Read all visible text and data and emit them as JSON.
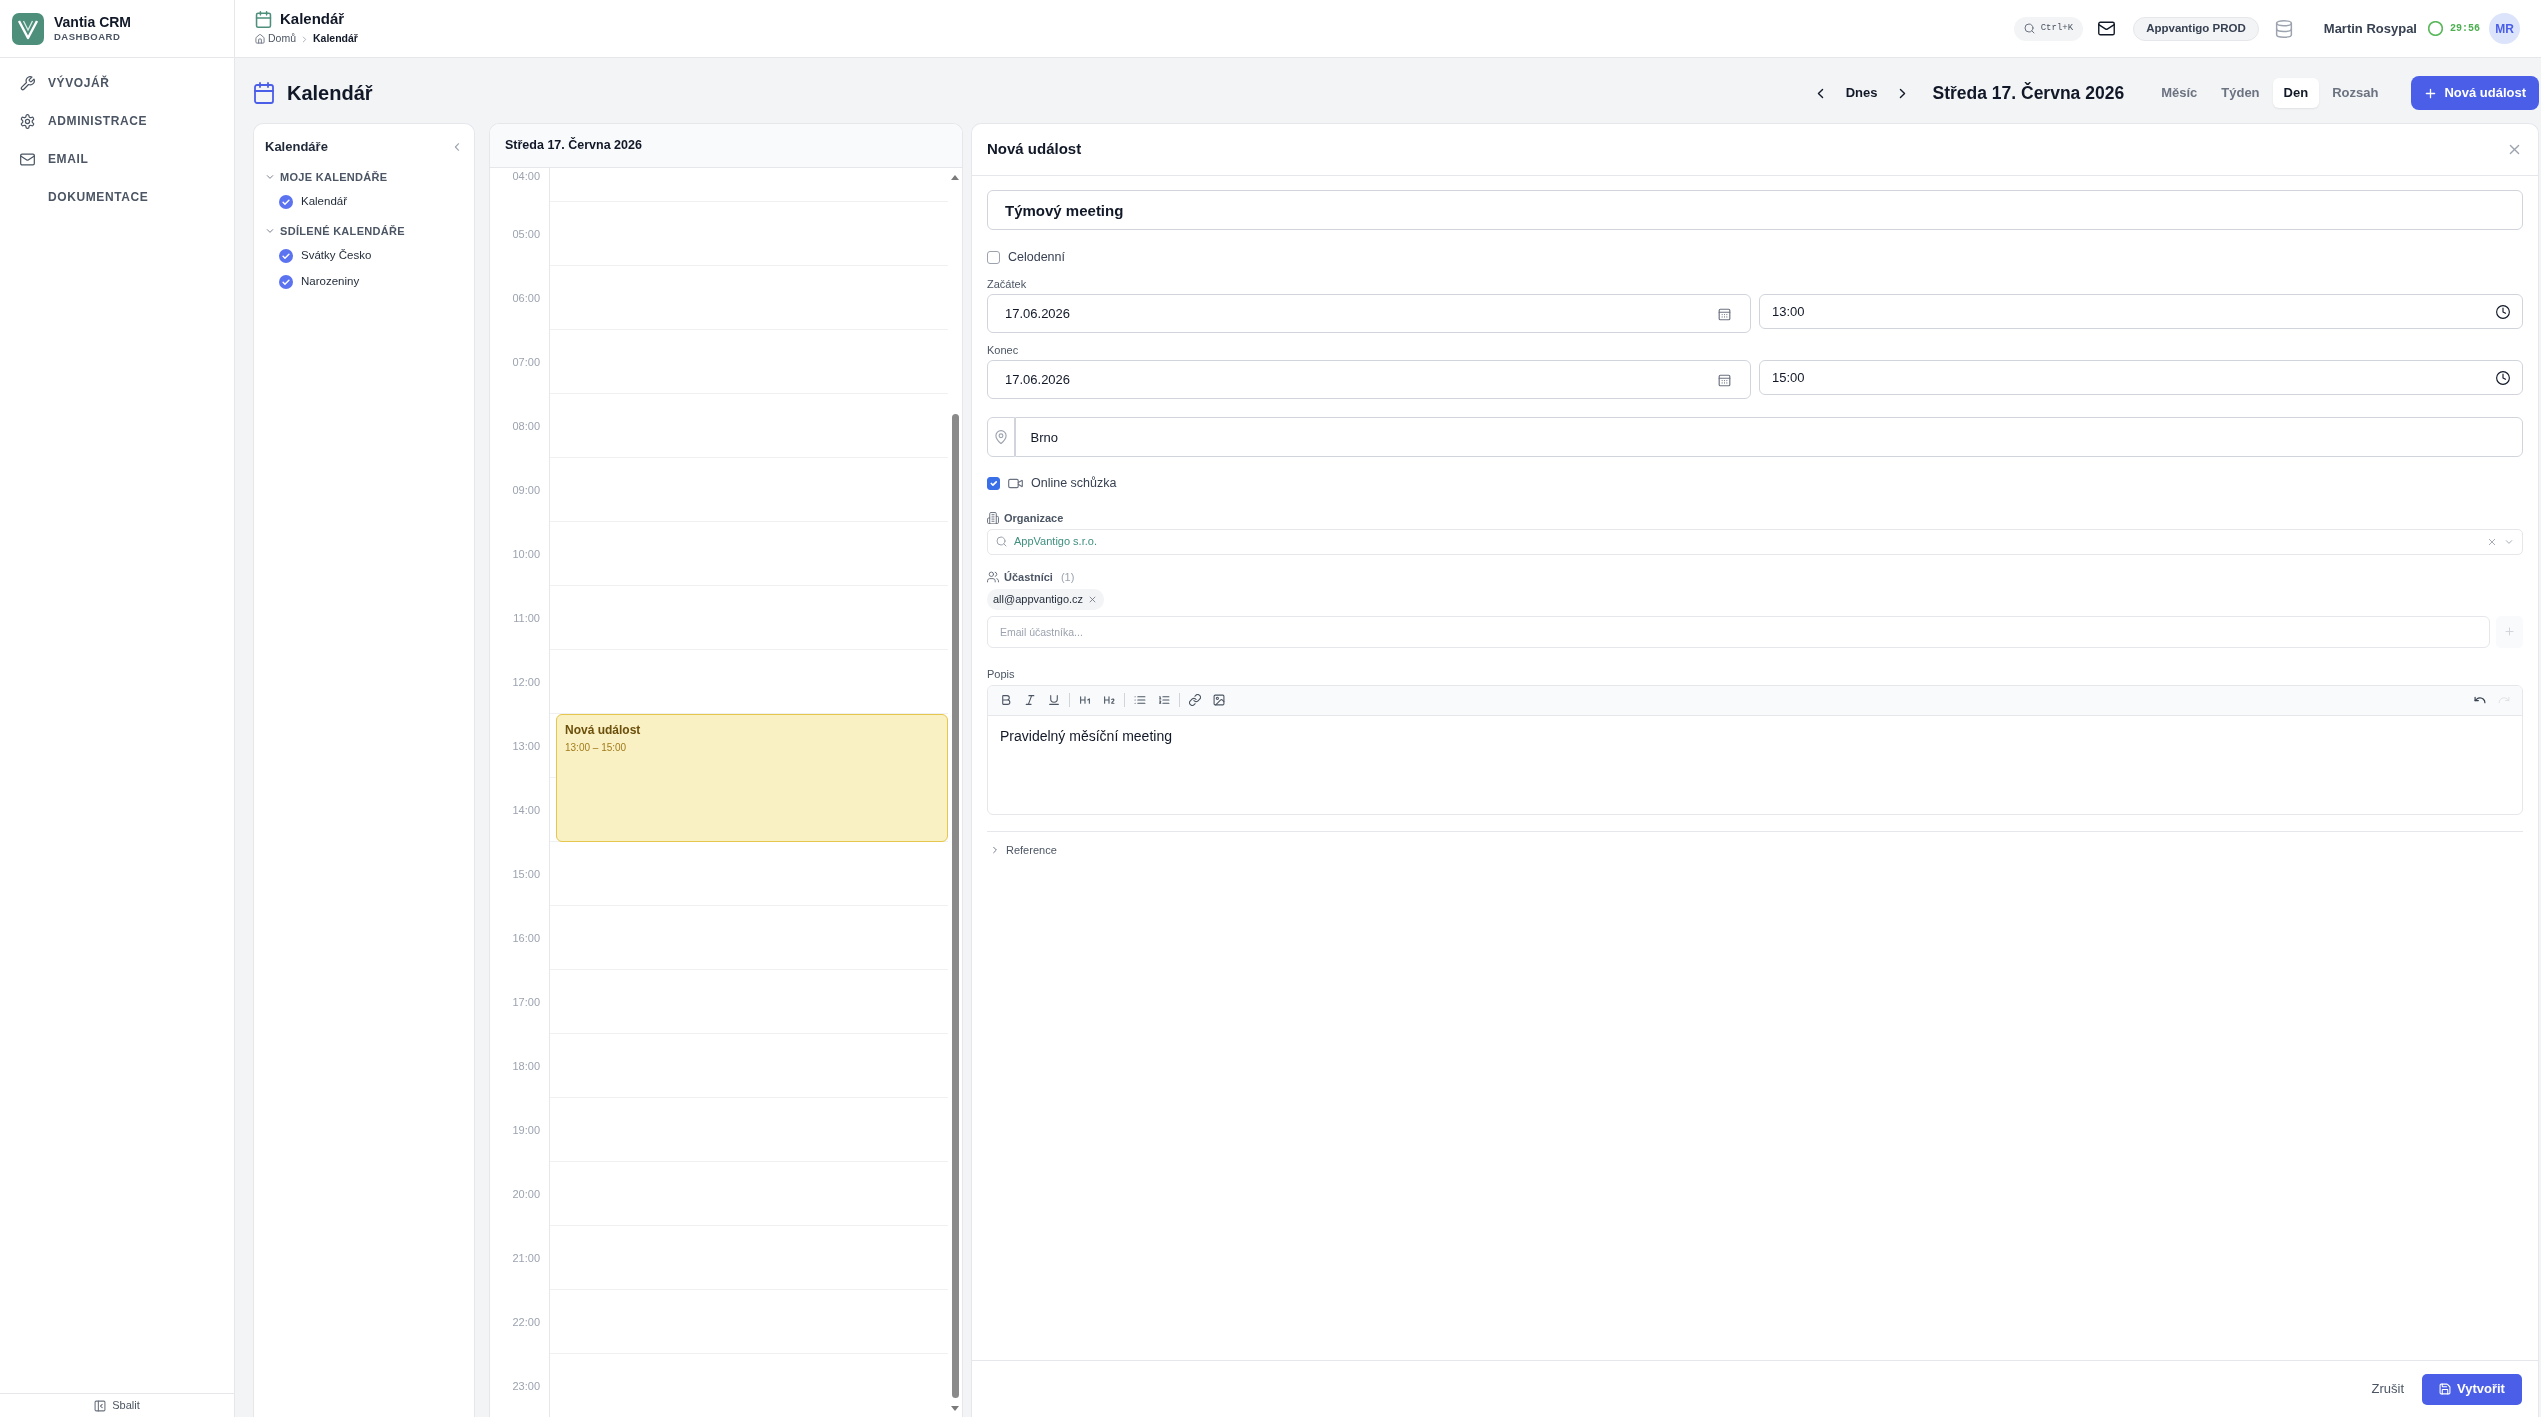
{
  "app": {
    "name": "Vantia CRM",
    "subtitle": "DASHBOARD"
  },
  "sidebar": {
    "items": [
      {
        "kind": "tools",
        "label": "VÝVOJÁŘ"
      },
      {
        "kind": "settings",
        "label": "ADMINISTRACE"
      },
      {
        "kind": "email",
        "label": "EMAIL"
      },
      {
        "kind": "docs",
        "label": "DOKUMENTACE"
      }
    ],
    "collapse_label": "Sbalit"
  },
  "header": {
    "title": "Kalendář",
    "breadcrumb": [
      {
        "kind": "home",
        "label": "Domů"
      },
      {
        "kind": "current",
        "label": "Kalendář"
      }
    ],
    "search_shortcut": "Ctrl+K",
    "environment": "Appvantigo PROD",
    "user_name": "Martin Rosypal",
    "session_timer": "29:56",
    "avatar_initials": "MR"
  },
  "page": {
    "title": "Kalendář"
  },
  "toolbar": {
    "today_label": "Dnes",
    "date_label": "Středa 17. Června 2026",
    "views": [
      {
        "label": "Měsíc",
        "selected": false
      },
      {
        "label": "Týden",
        "selected": false
      },
      {
        "label": "Den",
        "selected": true
      },
      {
        "label": "Rozsah",
        "selected": false
      }
    ],
    "new_event_label": "Nová událost"
  },
  "calendars": {
    "title": "Kalendáře",
    "groups": [
      {
        "label": "MOJE KALENDÁŘE",
        "expanded": true,
        "items": [
          {
            "label": "Kalendář",
            "checked": true
          }
        ]
      },
      {
        "label": "SDÍLENÉ KALENDÁŘE",
        "expanded": true,
        "items": [
          {
            "label": "Svátky Česko",
            "checked": true
          },
          {
            "label": "Narozeniny",
            "checked": true
          }
        ]
      }
    ]
  },
  "day_view": {
    "title": "Středa 17. Června 2026",
    "hours": [
      {
        "label": "04:00"
      },
      {
        "label": "05:00"
      },
      {
        "label": "06:00"
      },
      {
        "label": "07:00"
      },
      {
        "label": "08:00"
      },
      {
        "label": "09:00"
      },
      {
        "label": "10:00"
      },
      {
        "label": "11:00"
      },
      {
        "label": "12:00"
      },
      {
        "label": "13:00",
        "events": [
          {
            "title": "Nová událost",
            "time": "13:00 – 15:00"
          }
        ]
      },
      {
        "label": "14:00"
      },
      {
        "label": "15:00"
      },
      {
        "label": "16:00"
      },
      {
        "label": "17:00"
      },
      {
        "label": "18:00"
      },
      {
        "label": "19:00"
      },
      {
        "label": "20:00"
      },
      {
        "label": "21:00"
      },
      {
        "label": "22:00"
      },
      {
        "label": "23:00"
      }
    ]
  },
  "event_form": {
    "title": "Nová událost",
    "name": {
      "value": "Týmový meeting"
    },
    "all_day": {
      "label": "Celodenní",
      "checked": false
    },
    "start": {
      "label": "Začátek",
      "date": "17.06.2026",
      "time": "13:00"
    },
    "end": {
      "label": "Konec",
      "date": "17.06.2026",
      "time": "15:00"
    },
    "location": {
      "value": "Brno"
    },
    "online": {
      "label": "Online schůzka",
      "checked": true
    },
    "organization": {
      "label": "Organizace",
      "value": "AppVantigo s.r.o."
    },
    "participants": {
      "label": "Účastníci",
      "count": "(1)",
      "chips": [
        {
          "label": "all@appvantigo.cz"
        }
      ],
      "placeholder": "Email účastníka...",
      "add_disabled": true
    },
    "description": {
      "label": "Popis",
      "tool_groups": [
        [
          {
            "kind": "bold"
          },
          {
            "kind": "italic"
          },
          {
            "kind": "underline"
          }
        ],
        [
          {
            "kind": "heading1"
          },
          {
            "kind": "heading2"
          }
        ],
        [
          {
            "kind": "bullets"
          },
          {
            "kind": "numbered"
          }
        ],
        [
          {
            "kind": "link"
          },
          {
            "kind": "image"
          }
        ]
      ],
      "history": [
        {
          "kind": "undo",
          "disabled": false
        },
        {
          "kind": "redo",
          "disabled": true
        }
      ],
      "text": "Pravidelný měsíční meeting"
    },
    "reference": {
      "label": "Reference",
      "expanded": false
    },
    "cancel_label": "Zrušit",
    "submit_label": "Vytvořit"
  }
}
